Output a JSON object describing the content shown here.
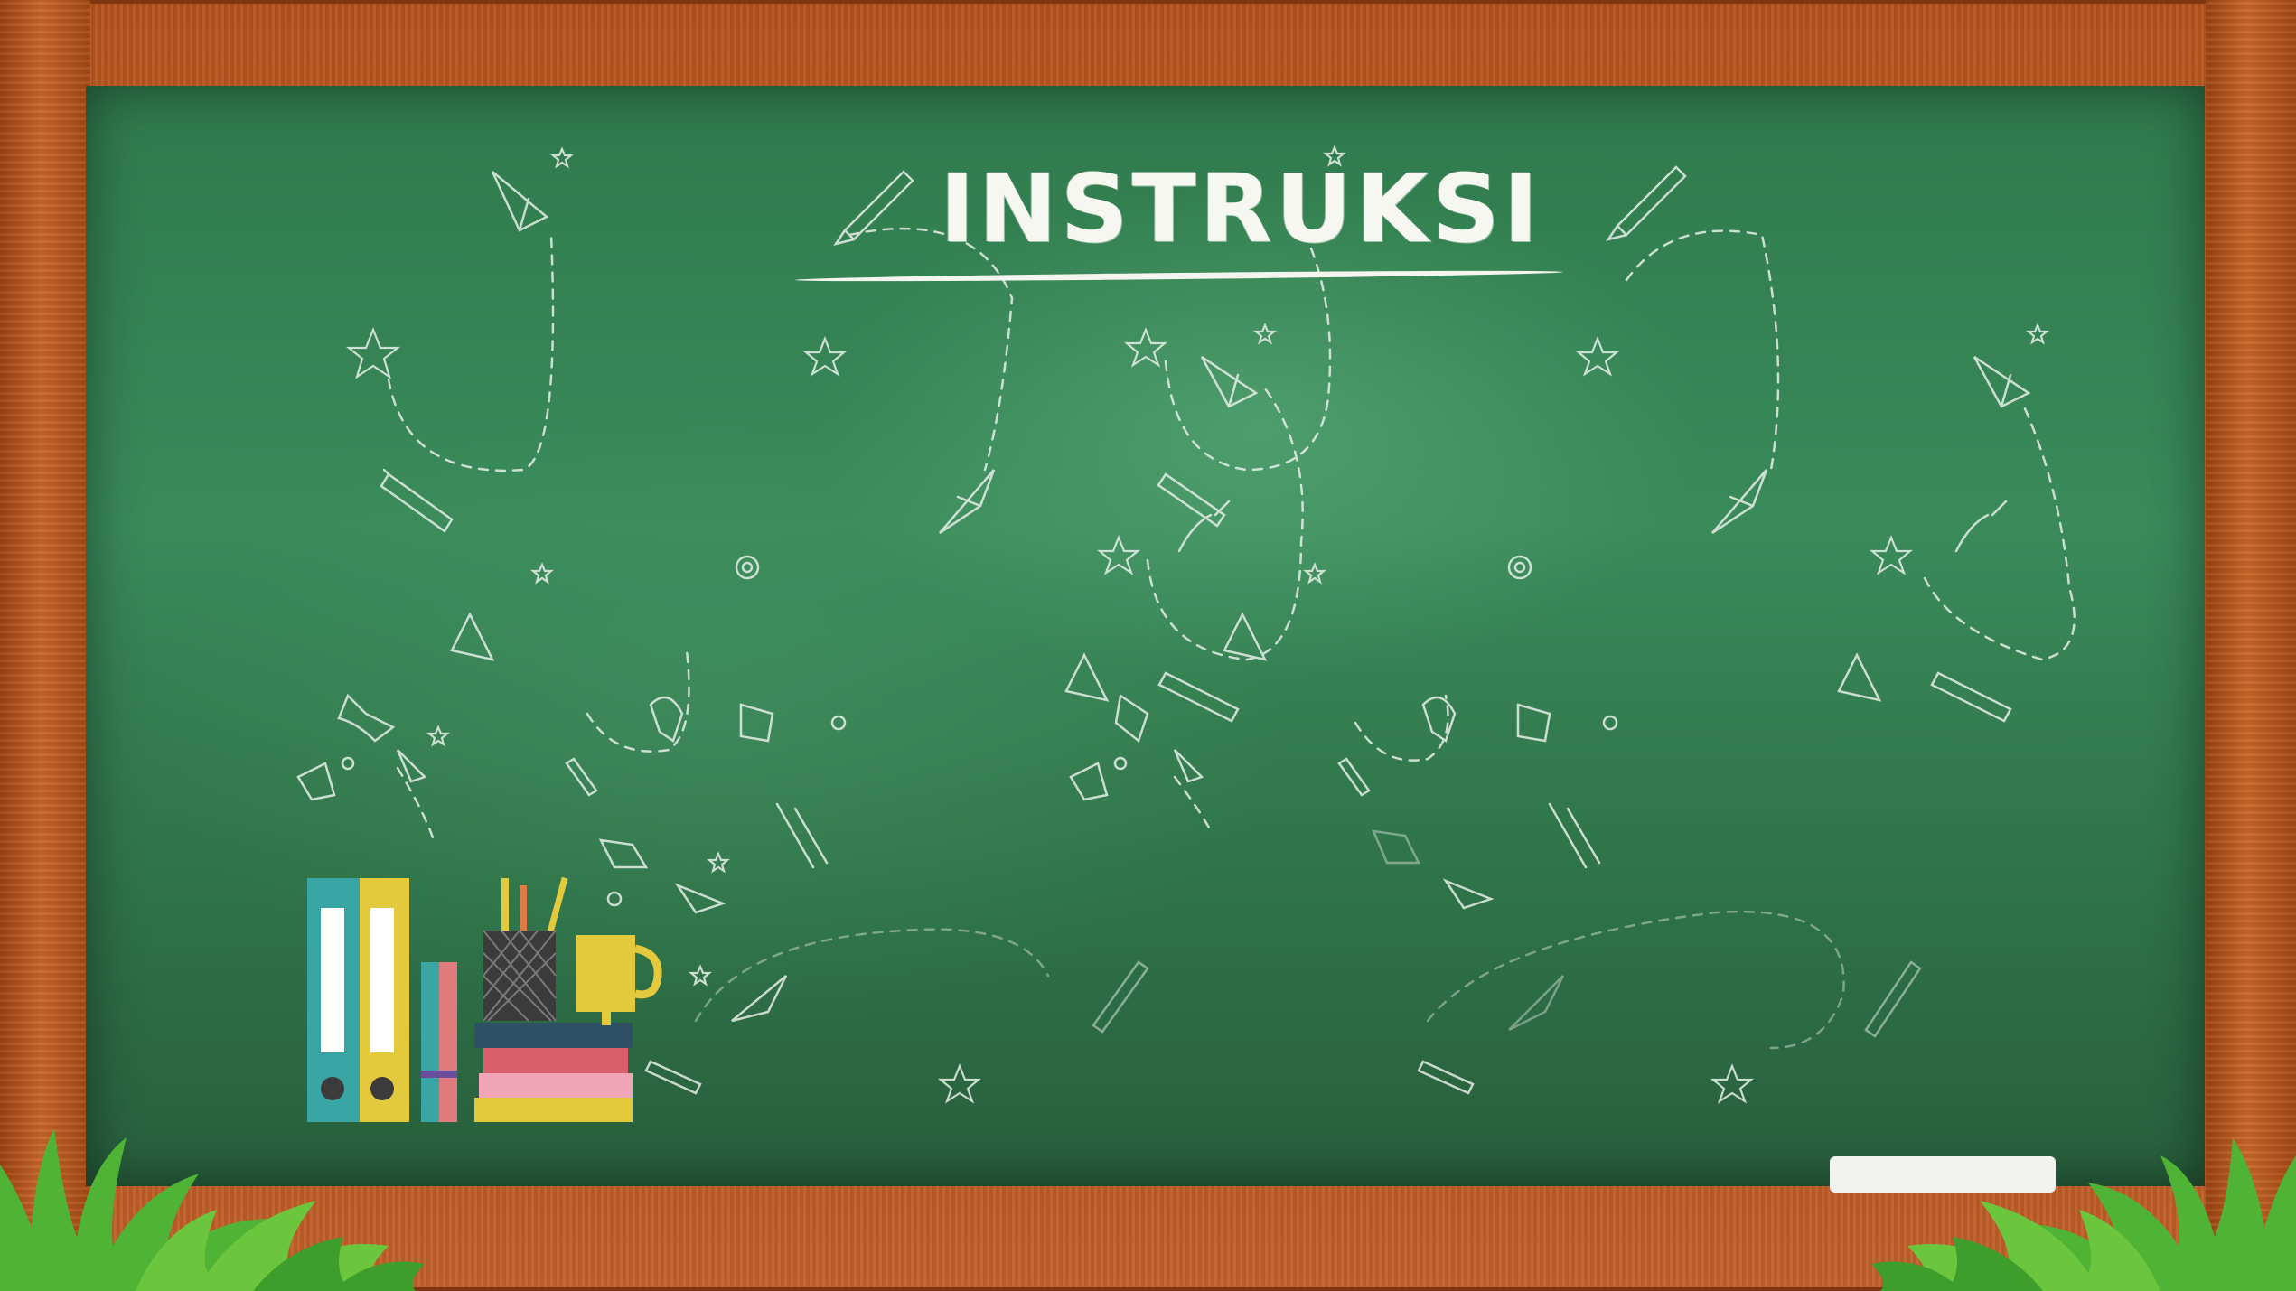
{
  "slide": {
    "title": "INSTRUKSI"
  },
  "colors": {
    "board": "#2f7a4c",
    "frame": "#b3521c",
    "chalk": "#f7f7f2",
    "grass": "#4fb335"
  },
  "icons": [
    "paper-plane-icon",
    "pencil-icon",
    "star-icon",
    "book-icon",
    "spiral-icon",
    "bell-icon",
    "formula-icon"
  ]
}
